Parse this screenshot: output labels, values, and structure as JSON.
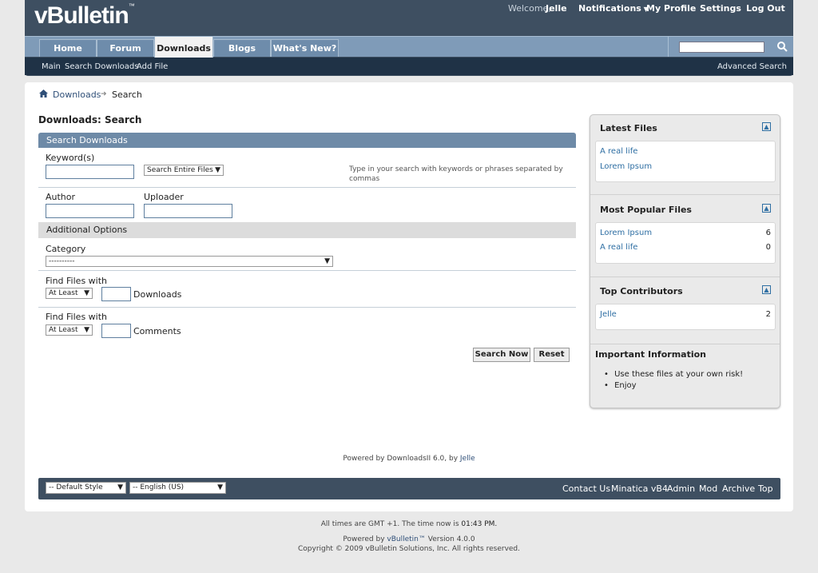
{
  "header": {
    "logo": "vBulletin",
    "logo_tm": "™",
    "welcome_label": "Welcome,",
    "username": "Jelle",
    "notifications": "Notifications",
    "my_profile": "My Profile",
    "settings": "Settings",
    "logout": "Log Out"
  },
  "nav": {
    "tabs": [
      {
        "label": "Home"
      },
      {
        "label": "Forum"
      },
      {
        "label": "Downloads",
        "active": true
      },
      {
        "label": "Blogs"
      },
      {
        "label": "What's New?"
      }
    ],
    "search_placeholder": "",
    "sublinks": [
      "Main",
      "Search Downloads",
      "Add File"
    ],
    "advanced_search": "Advanced Search"
  },
  "breadcrumb": {
    "items": [
      "Downloads",
      "Search"
    ]
  },
  "page_title": "Downloads: Search",
  "search_form": {
    "header": "Search Downloads",
    "keywords_label": "Keyword(s)",
    "keywords_value": "",
    "scope_select": "Search Entire Files",
    "hint": "Type in your search with keywords or phrases separated by commas",
    "author_label": "Author",
    "author_value": "",
    "uploader_label": "Uploader",
    "uploader_value": "",
    "additional_options": "Additional Options",
    "category_label": "Category",
    "category_select": "----------",
    "downloads_label": "Find Files with",
    "downloads_compare": "At Least",
    "downloads_value": "",
    "downloads_unit": "Downloads",
    "comments_label": "Find Files with",
    "comments_compare": "At Least",
    "comments_value": "",
    "comments_unit": "Comments",
    "search_button": "Search Now",
    "reset_button": "Reset"
  },
  "sidebar": {
    "latest": {
      "title": "Latest Files",
      "files": [
        "A real life",
        "Lorem Ipsum"
      ]
    },
    "popular": {
      "title": "Most Popular Files",
      "files": [
        {
          "name": "Lorem Ipsum",
          "count": "6"
        },
        {
          "name": "A real life",
          "count": "0"
        }
      ]
    },
    "contributors": {
      "title": "Top Contributors",
      "users": [
        {
          "name": "Jelle",
          "count": "2"
        }
      ]
    },
    "info": {
      "title": "Important Information",
      "items": [
        "Use these files at your own risk!",
        "Enjoy"
      ]
    }
  },
  "footer": {
    "powered_text": "Powered by DownloadsII 6.0, by",
    "powered_author": "Jelle",
    "style_select": "-- Default Style",
    "language_select": "-- English (US)",
    "links": [
      "Contact Us",
      "Minatica vB4",
      "Admin",
      "Mod",
      "Archive",
      "Top"
    ],
    "time_text": "All times are GMT +1. The time now is",
    "time_value": "01:43 PM.",
    "vb_powered_prefix": "Powered by",
    "vb_powered_link": "vBulletin™",
    "vb_version": "Version 4.0.0",
    "copyright": "Copyright © 2009 vBulletin Solutions, Inc. All rights reserved."
  }
}
